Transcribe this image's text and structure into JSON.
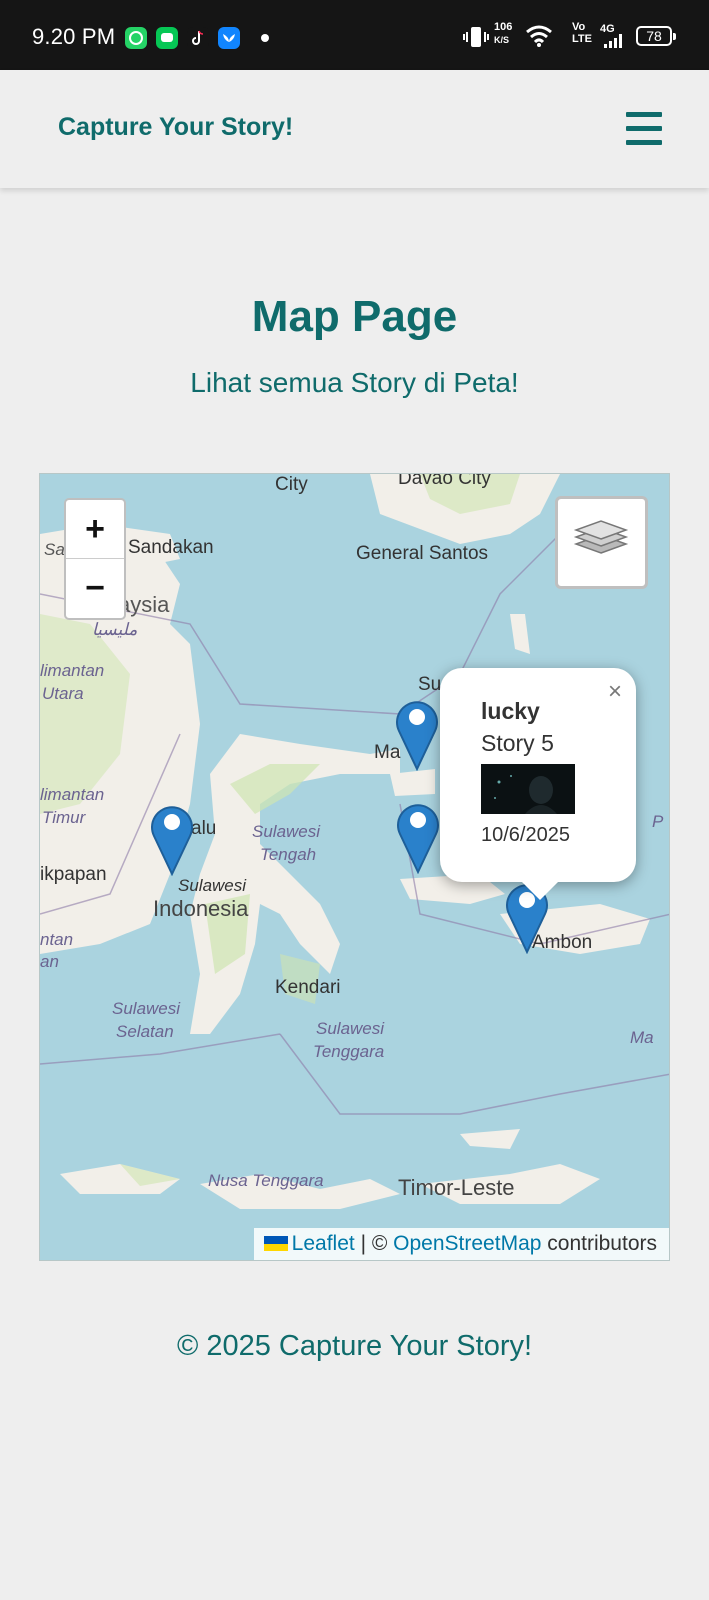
{
  "status_bar": {
    "time": "9.20 PM",
    "net_speed_value": "106",
    "net_speed_unit": "K/S",
    "volte_top": "Vo",
    "volte_bottom": "LTE",
    "network": "4G",
    "battery": "78",
    "icons": [
      "whatsapp-icon",
      "line-icon",
      "tiktok-icon",
      "bluesky-icon",
      "vibrate-icon",
      "wifi-icon",
      "signal-icon",
      "battery-icon"
    ]
  },
  "header": {
    "brand": "Capture Your Story!",
    "menu_icon": "hamburger-menu-icon"
  },
  "page": {
    "title": "Map Page",
    "subtitle": "Lihat semua Story di Peta!"
  },
  "map": {
    "zoom_in": "+",
    "zoom_out": "−",
    "layers_icon": "layers-icon",
    "place_labels": [
      "City",
      "Davao City",
      "Sandakan",
      "General Santos",
      "Sa",
      "aysia",
      "مليسيا",
      "limantan",
      "Utara",
      "limantan",
      "Timur",
      "ikpapan",
      "ntan",
      "an",
      "Ma",
      "Su",
      "alu",
      "Sulawesi",
      "Tengah",
      "Sulawesi",
      "Indonesia",
      "Kendari",
      "Sulawesi",
      "Selatan",
      "Sulawesi",
      "Tenggara",
      "Ambon",
      "Ma",
      "P",
      "Nusa Tenggara",
      "Timor-Leste"
    ],
    "popup": {
      "close": "×",
      "username": "lucky",
      "story": "Story 5",
      "date": "10/6/2025"
    },
    "attribution": {
      "leaflet": "Leaflet",
      "separator": " | © ",
      "osm": "OpenStreetMap",
      "contributors": " contributors"
    }
  },
  "footer": {
    "text": "© 2025 Capture Your Story!"
  },
  "colors": {
    "accent": "#0f6b6b",
    "background": "#eeeeee",
    "water": "#aad3df",
    "land": "#f2efe9",
    "marker": "#2a81cb",
    "link": "#0078a8"
  }
}
